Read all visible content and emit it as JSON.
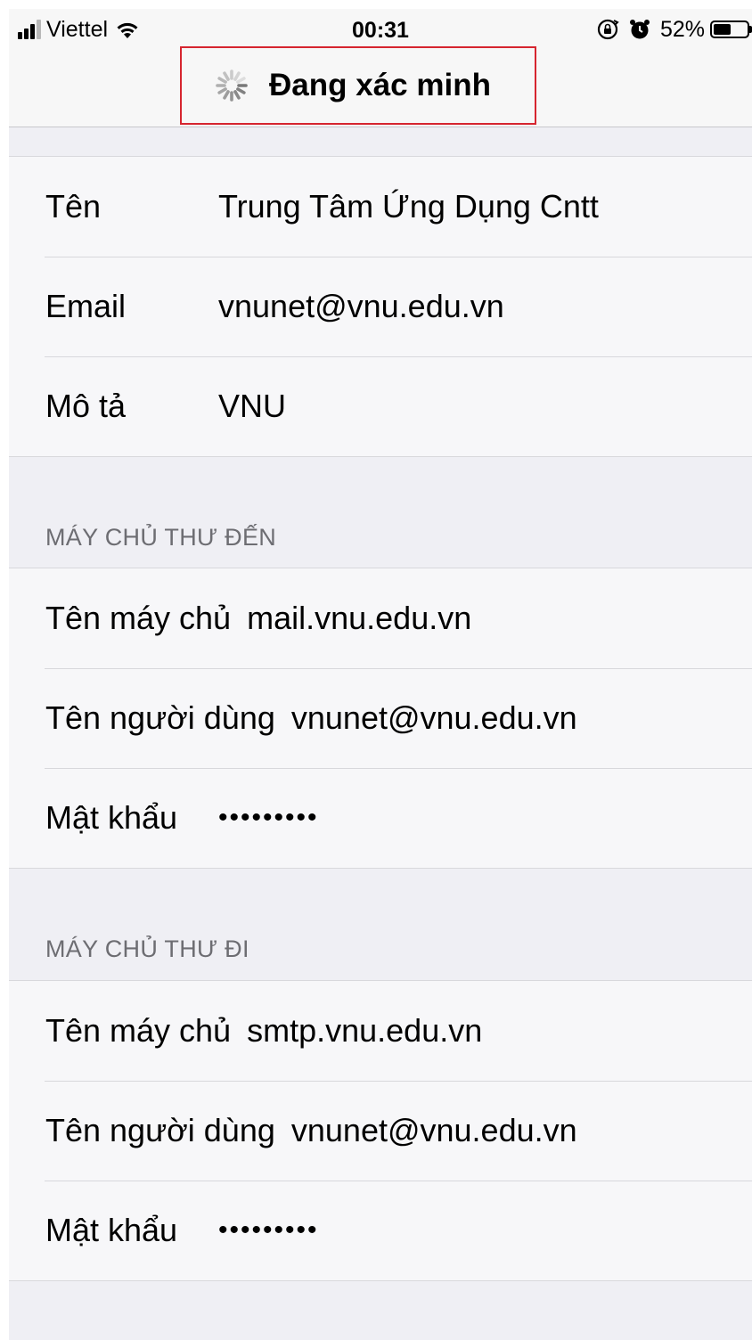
{
  "status_bar": {
    "carrier": "Viettel",
    "time": "00:31",
    "battery_percent": "52%",
    "battery_level": 0.52,
    "signal_bars_filled": 3,
    "signal_bars_total": 4,
    "icons": [
      "signal-icon",
      "wifi-icon",
      "orientation-lock-icon",
      "alarm-icon",
      "battery-icon"
    ]
  },
  "nav_bar": {
    "title": "Đang xác minh",
    "highlight_color": "#d6252f",
    "icon": "spinner-icon"
  },
  "account": {
    "rows": [
      {
        "label": "Tên",
        "value": "Trung Tâm Ứng Dụng Cntt"
      },
      {
        "label": "Email",
        "value": "vnunet@vnu.edu.vn"
      },
      {
        "label": "Mô tả",
        "value": "VNU"
      }
    ]
  },
  "incoming": {
    "header": "MÁY CHỦ THƯ ĐẾN",
    "hostname_label": "Tên máy chủ",
    "hostname_value": "mail.vnu.edu.vn",
    "username_label": "Tên người dùng",
    "username_value": "vnunet@vnu.edu.vn",
    "password_label": "Mật khẩu",
    "password_value": "•••••••••"
  },
  "outgoing": {
    "header": "MÁY CHỦ THƯ ĐI",
    "hostname_label": "Tên máy chủ",
    "hostname_value": "smtp.vnu.edu.vn",
    "username_label": "Tên người dùng",
    "username_value": "vnunet@vnu.edu.vn",
    "password_label": "Mật khẩu",
    "password_value": "•••••••••"
  }
}
